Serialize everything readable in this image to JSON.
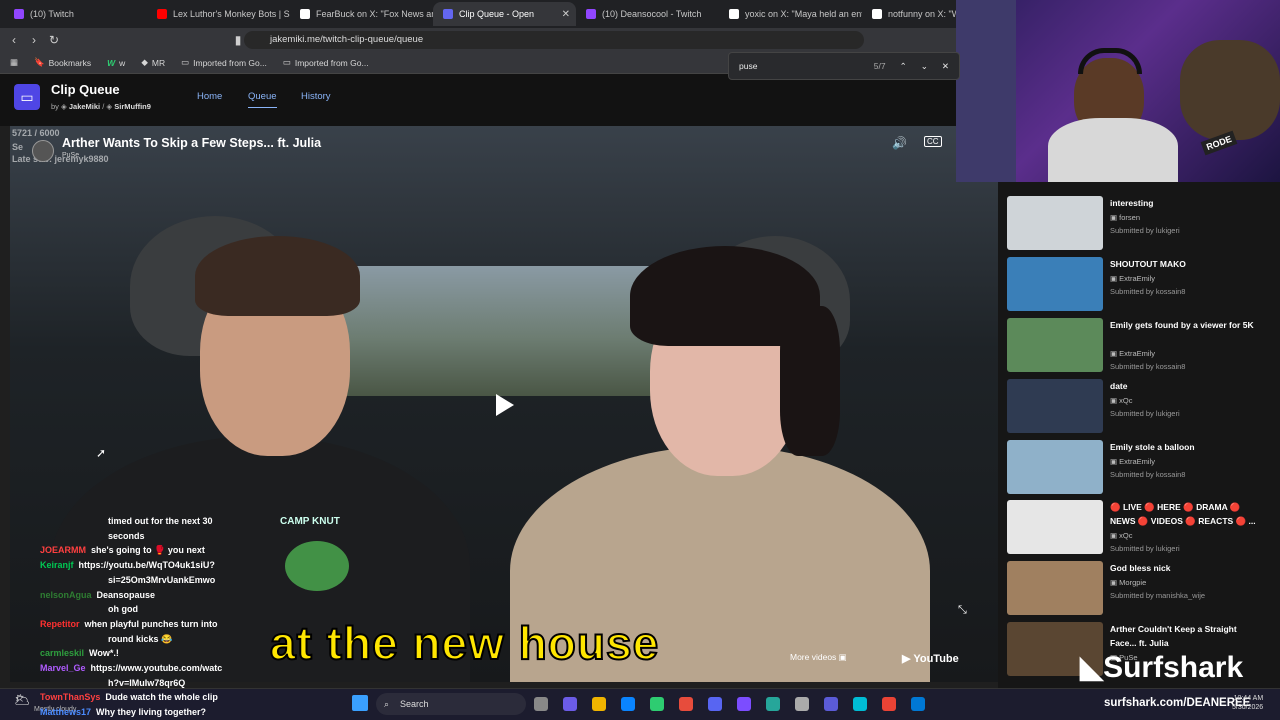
{
  "browser_tabs": [
    {
      "label": "(10) Twitch",
      "color": "#9146ff"
    },
    {
      "label": "Lex Luthor's Monkey Bots | SU",
      "color": "#ff0000"
    },
    {
      "label": "FearBuck on X: \"Fox News and",
      "color": "#ffffff"
    },
    {
      "label": "Clip Queue - Open",
      "color": "#6366f1",
      "active": true
    },
    {
      "label": "(10) Deansocool - Twitch",
      "color": "#9146ff"
    },
    {
      "label": "yoxic on X: \"Maya held an enti",
      "color": "#ffffff"
    },
    {
      "label": "notfunny on X: \"Why",
      "color": "#ffffff"
    }
  ],
  "url": "jakemiki.me/twitch-clip-queue/queue",
  "bookmarks": [
    "Bookmarks",
    "w",
    "MR",
    "Imported from Go...",
    "Imported from Go..."
  ],
  "find": {
    "query": "puse",
    "count": "5/7"
  },
  "app": {
    "title": "Clip Queue",
    "by": "by",
    "author1": "JakeMiki",
    "sep": "/",
    "author2": "SirMuffin9",
    "nav": [
      "Home",
      "Queue",
      "History"
    ]
  },
  "video": {
    "title": "Arther Wants To Skip a Few Steps... ft. Julia",
    "channel": "PuSe",
    "overlay1": "5721 / 6000",
    "overlay2": "Se",
    "overlay3": "Late sub: jeremyk9880",
    "caption": "at the new house",
    "more_videos": "More videos",
    "youtube": "YouTube"
  },
  "chat": [
    {
      "user": "",
      "color": "#fff",
      "msg": "timed out for the next 30"
    },
    {
      "user": "",
      "color": "#fff",
      "msg": "seconds"
    },
    {
      "user": "JOEARMM",
      "color": "#ff4040",
      "msg": "she's going to 🥊 you next"
    },
    {
      "user": "Keiranjf",
      "color": "#00c853",
      "msg": "https://youtu.be/WqTO4uk1siU?"
    },
    {
      "user": "",
      "color": "#fff",
      "msg": "si=25Om3MrvUankEmwo"
    },
    {
      "user": "nelsonAgua",
      "color": "#2e7d32",
      "msg": "Deansopause"
    },
    {
      "user": "",
      "color": "#fff",
      "msg": "oh god"
    },
    {
      "user": "Repetitor",
      "color": "#ff3030",
      "msg": "when playful punches turn into"
    },
    {
      "user": "",
      "color": "#fff",
      "msg": "round kicks 😂"
    },
    {
      "user": "carmleskil",
      "color": "#2e9e3e",
      "msg": "Wow*.!"
    },
    {
      "user": "Marvel_Ge",
      "color": "#b05cff",
      "msg": "https://www.youtube.com/watc"
    },
    {
      "user": "",
      "color": "#fff",
      "msg": "h?v=IMuIw78qr6Q"
    },
    {
      "user": "TownThanSys",
      "color": "#ff4040",
      "msg": "Dude watch the whole clip"
    },
    {
      "user": "Matthews17",
      "color": "#4b8cff",
      "msg": "Why they living together?"
    }
  ],
  "queue": [
    {
      "title": "interesting",
      "channel": "forsen",
      "submitted": "Submitted by lukigeri",
      "thumb": "#cfd4d8"
    },
    {
      "title": "SHOUTOUT MAKO",
      "channel": "ExtraEmily",
      "submitted": "Submitted by kossain8",
      "thumb": "#3a7fb8"
    },
    {
      "title": "Emily gets found by a viewer for 5K",
      "channel": "ExtraEmily",
      "submitted": "Submitted by kossain8",
      "thumb": "#5c8a5a"
    },
    {
      "title": "date",
      "channel": "xQc",
      "submitted": "Submitted by lukigeri",
      "thumb": "#2f3b52"
    },
    {
      "title": "Emily stole a balloon",
      "channel": "ExtraEmily",
      "submitted": "Submitted by kossain8",
      "thumb": "#8fb1c9"
    },
    {
      "title": "🔴 LIVE 🔴 HERE 🔴 DRAMA 🔴 NEWS 🔴 VIDEOS 🔴 REACTS 🔴 ...",
      "channel": "xQc",
      "submitted": "Submitted by lukigeri",
      "thumb": "#e6e6e6"
    },
    {
      "title": "God bless nick",
      "channel": "Morgpie",
      "submitted": "Submitted by manishka_wije",
      "thumb": "#a08060"
    },
    {
      "title": "Arther Couldn't Keep a Straight Face... ft. Julia",
      "channel": "PuSe",
      "submitted": "",
      "thumb": "#5a4632"
    }
  ],
  "sponsor": {
    "name": "Surfshark",
    "url": "surfshark.com/DEANEREE"
  },
  "taskbar": {
    "search": "Search"
  },
  "webcam": {
    "mic_label": "RODE"
  },
  "status_text": "Mostly cloudy",
  "clock": {
    "time": "10:44 AM",
    "date": "5/30/2026"
  }
}
